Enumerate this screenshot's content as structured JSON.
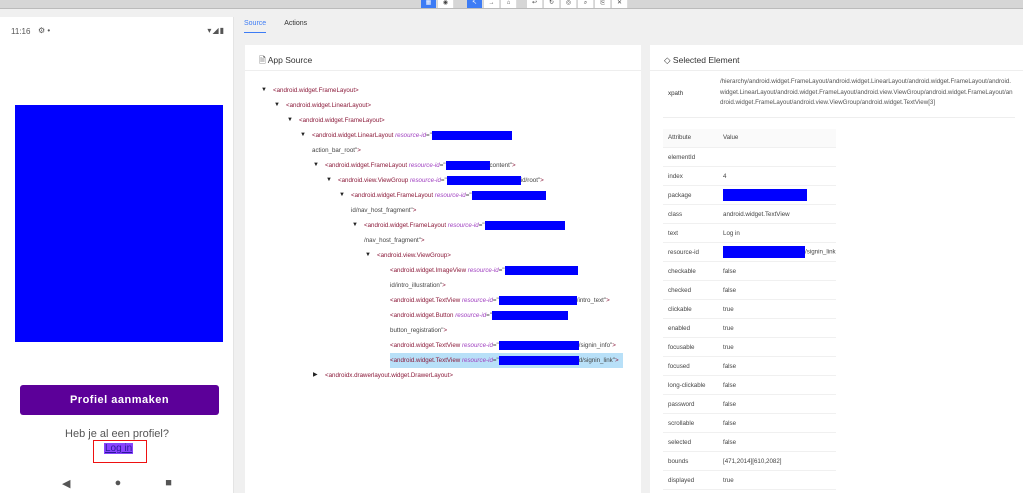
{
  "toolbar": {
    "buttons": [
      "grid-icon",
      "globe-icon",
      "select-icon",
      "swipe-icon",
      "tap-icon",
      "back-icon",
      "refresh-icon",
      "eye-icon",
      "search-icon",
      "copy-icon",
      "close-icon"
    ]
  },
  "device": {
    "time": "11:16",
    "status_icons": "▾◢▮",
    "button_label": "Profiel aanmaken",
    "question": "Heb je al een profiel?",
    "link": "Log in",
    "nav": [
      "◀",
      "●",
      "■"
    ]
  },
  "tabs": [
    "Source",
    "Actions"
  ],
  "source": {
    "title": "App Source",
    "nodes": [
      {
        "level": 0,
        "exp": "open",
        "tag": "android.widget.FrameLayout"
      },
      {
        "level": 1,
        "exp": "open",
        "tag": "android.widget.LinearLayout"
      },
      {
        "level": 2,
        "exp": "open",
        "tag": "android.widget.FrameLayout"
      },
      {
        "level": 3,
        "exp": "open",
        "tag": "android.widget.LinearLayout",
        "attr": "resource-id",
        "suffix": "action_bar_root"
      },
      {
        "level": 4,
        "exp": "open",
        "tag": "android.widget.FrameLayout",
        "attr": "resource-id",
        "suffix": "content"
      },
      {
        "level": 5,
        "exp": "open",
        "tag": "android.view.ViewGroup",
        "attr": "resource-id",
        "suffix": "id/root"
      },
      {
        "level": 6,
        "exp": "open",
        "tag": "android.widget.FrameLayout",
        "attr": "resource-id",
        "suffix": "id/nav_host_fragment"
      },
      {
        "level": 7,
        "exp": "open",
        "tag": "android.widget.FrameLayout",
        "attr": "resource-id",
        "suffix": "/nav_host_fragment"
      },
      {
        "level": 8,
        "exp": "open",
        "tag": "android.view.ViewGroup"
      },
      {
        "level": 9,
        "tag": "android.widget.ImageView",
        "attr": "resource-id",
        "suffix": "id/intro_illustration"
      },
      {
        "level": 9,
        "tag": "android.widget.TextView",
        "attr": "resource-id",
        "suffix": "/intro_text"
      },
      {
        "level": 9,
        "tag": "android.widget.Button",
        "attr": "resource-id",
        "suffix": "button_registration"
      },
      {
        "level": 9,
        "tag": "android.widget.TextView",
        "attr": "resource-id",
        "suffix": "/signin_info"
      },
      {
        "level": 9,
        "tag": "android.widget.TextView",
        "attr": "resource-id",
        "suffix": "d/signin_link",
        "selected": true
      },
      {
        "level": 4,
        "exp": "closed",
        "tag": "androidx.drawerlayout.widget.DrawerLayout"
      }
    ]
  },
  "selected": {
    "title": "Selected Element",
    "xpath_label": "xpath",
    "xpath": "/hierarchy/android.widget.FrameLayout/android.widget.LinearLayout/android.widget.FrameLayout/android.widget.LinearLayout/android.widget.FrameLayout/android.view.ViewGroup/android.widget.FrameLayout/android.widget.FrameLayout/android.view.ViewGroup/android.widget.TextView[3]",
    "headers": [
      "Attribute",
      "Value"
    ],
    "rows": [
      [
        "elementId",
        ""
      ],
      [
        "index",
        "4"
      ],
      [
        "package",
        null
      ],
      [
        "class",
        "android.widget.TextView"
      ],
      [
        "text",
        "Log in"
      ],
      [
        "resource-id",
        "/signin_link"
      ],
      [
        "checkable",
        "false"
      ],
      [
        "checked",
        "false"
      ],
      [
        "clickable",
        "true"
      ],
      [
        "enabled",
        "true"
      ],
      [
        "focusable",
        "true"
      ],
      [
        "focused",
        "false"
      ],
      [
        "long-clickable",
        "false"
      ],
      [
        "password",
        "false"
      ],
      [
        "scrollable",
        "false"
      ],
      [
        "selected",
        "false"
      ],
      [
        "bounds",
        "[471,2014][610,2082]"
      ],
      [
        "displayed",
        "true"
      ]
    ]
  }
}
